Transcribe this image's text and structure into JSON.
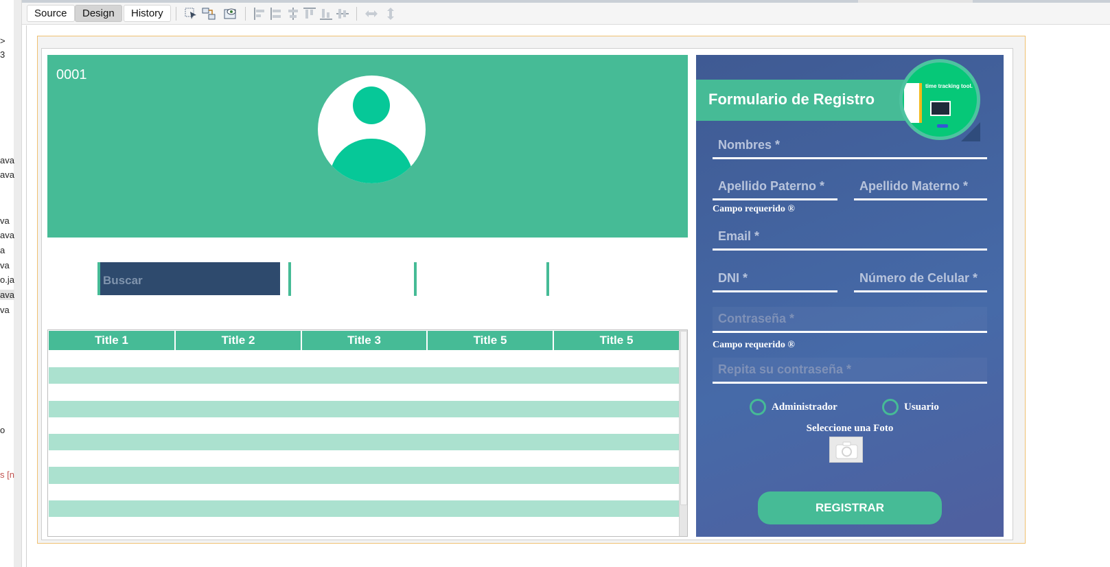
{
  "left_panel": {
    "fragments": [
      ">",
      "3",
      "ava",
      "ava",
      "va",
      "ava",
      "a",
      "va",
      "o.ja",
      "ava",
      "va",
      "o",
      "s [n"
    ]
  },
  "toolbar": {
    "tabs": [
      {
        "label": "Source",
        "active": false
      },
      {
        "label": "Design",
        "active": true
      },
      {
        "label": "History",
        "active": false
      }
    ],
    "icons": [
      "selection-mode-icon",
      "connection-mode-icon",
      "preview-design-icon",
      "align-left-icon",
      "align-right-icon",
      "center-horizontally-icon",
      "align-top-icon",
      "align-bottom-icon",
      "center-vertically-icon",
      "same-width-icon",
      "same-height-icon"
    ]
  },
  "header": {
    "profile_number": "0001",
    "accent_color": "#46bb96"
  },
  "search": {
    "placeholder": "Buscar"
  },
  "table": {
    "columns": [
      "Title 1",
      "Title 2",
      "Title 3",
      "Title 5",
      "Title 5"
    ],
    "rows": [
      [
        "",
        "",
        "",
        "",
        ""
      ],
      [
        "",
        "",
        "",
        "",
        ""
      ],
      [
        "",
        "",
        "",
        "",
        ""
      ],
      [
        "",
        "",
        "",
        "",
        ""
      ],
      [
        "",
        "",
        "",
        "",
        ""
      ],
      [
        "",
        "",
        "",
        "",
        ""
      ],
      [
        "",
        "",
        "",
        "",
        ""
      ],
      [
        "",
        "",
        "",
        "",
        ""
      ],
      [
        "",
        "",
        "",
        "",
        ""
      ],
      [
        "",
        "",
        "",
        "",
        ""
      ],
      [
        "",
        "",
        "",
        "",
        ""
      ]
    ]
  },
  "form": {
    "title": "Formulario de Registro",
    "fields": {
      "nombres": "Nombres *",
      "apellido_paterno": "Apellido Paterno *",
      "apellido_materno": "Apellido Materno *",
      "email": "Email *",
      "dni": "DNI *",
      "celular": "Número de Celular *",
      "contrasena": "Contraseña *",
      "repita_contrasena": "Repita su contraseña *"
    },
    "required_note_1": "Campo requerido  ®",
    "required_note_2": "Campo requerido  ®",
    "role_admin": "Administrador",
    "role_user": "Usuario",
    "photo_label": "Seleccione una Foto",
    "submit_label": "REGISTRAR",
    "logo_text": "time tracking tool.",
    "panel_color": "#42609e"
  }
}
